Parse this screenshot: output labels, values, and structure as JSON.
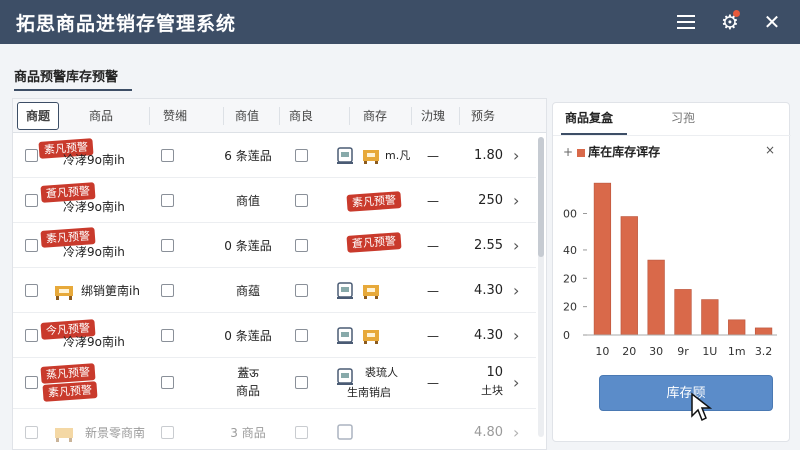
{
  "app": {
    "title": "拓思商品进销存管理系统"
  },
  "titlebar": {
    "menu_icon": "menu-icon",
    "gear_icon": "gear-icon",
    "close_icon": "close-icon",
    "close_glyph": "✕",
    "gear_glyph": "⚙"
  },
  "page": {
    "section_title": "商品预警库存预警"
  },
  "table": {
    "headers": [
      "商题",
      "商品",
      "赞缃",
      "商值",
      "商良",
      "商存",
      "氻瑰",
      "预务"
    ],
    "rows": [
      {
        "badge": "素凡预警",
        "name": "冷涍9o南ih",
        "center": "6 条莲品",
        "inv_text": "m.凡",
        "dash": "—",
        "price": "1.80"
      },
      {
        "badge": "蒼凡预警",
        "name": "冷涍9o南ih",
        "center": "商值",
        "inv_badge": "素凡预警",
        "dash": "—",
        "price": "250"
      },
      {
        "badge": "素凡预警",
        "name": "冷涍9o南ih",
        "center": "0 条莲品",
        "inv_badge": "蒼凡预警",
        "dash": "—",
        "price": "2.55"
      },
      {
        "name": "绑销筻南ih",
        "center": "商蕴",
        "dash": "—",
        "price": "4.30"
      },
      {
        "badge": "今凡预警",
        "name": "冷涍9o南ih",
        "center": "0 条莲品",
        "dash": "—",
        "price": "4.30"
      },
      {
        "badge": "蒸凡预警",
        "badge2": "素凡预警",
        "name": "",
        "center": "蓋ऊ",
        "center2": "商品",
        "inv_text": "裘琉人",
        "inv_text2": "生南销启",
        "dash": "—",
        "price": "10",
        "price2": "土块"
      },
      {
        "name": "新景零商南",
        "center": "3 商品",
        "dash": "",
        "price": "4.80"
      }
    ]
  },
  "side": {
    "tabs": [
      "商品复盒",
      "习孢"
    ],
    "legend": "库在库存诨存",
    "plus": "+",
    "close": "×",
    "cta": "库存顾"
  },
  "chart_data": {
    "type": "bar",
    "title": "",
    "categories": [
      "10",
      "20",
      "30",
      "9r",
      "1U",
      "1m",
      "3.2"
    ],
    "values": [
      150,
      117,
      74,
      45,
      35,
      15,
      7
    ],
    "y_tick_labels": [
      "0",
      "20",
      "20",
      "40",
      "00"
    ],
    "ylim": [
      0,
      160
    ],
    "bar_color": "#d9694a"
  }
}
